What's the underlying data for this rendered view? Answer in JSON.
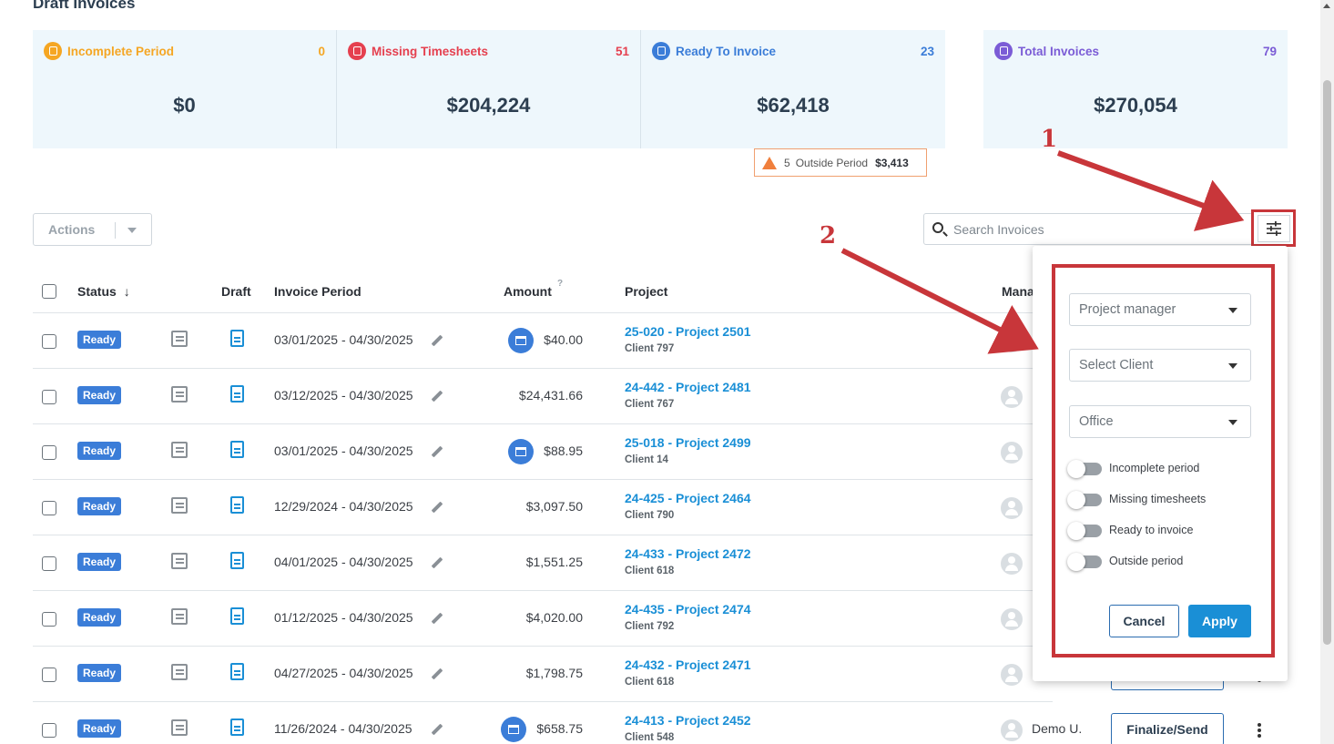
{
  "page": {
    "title": "Draft Invoices"
  },
  "cards": [
    {
      "label": "Incomplete Period",
      "count": "0",
      "amount": "$0",
      "color": "#f5a623"
    },
    {
      "label": "Missing Timesheets",
      "count": "51",
      "amount": "$204,224",
      "color": "#e5404f"
    },
    {
      "label": "Ready To Invoice",
      "count": "23",
      "amount": "$62,418",
      "color": "#3b7dd8"
    },
    {
      "label": "Total Invoices",
      "count": "79",
      "amount": "$270,054",
      "color": "#7b5cd6"
    }
  ],
  "outside_period": {
    "count": "5",
    "label": "Outside Period",
    "amount": "$3,413"
  },
  "toolbar": {
    "actions_label": "Actions",
    "search_placeholder": "Search Invoices"
  },
  "table": {
    "headers": {
      "status": "Status",
      "draft": "Draft",
      "period": "Invoice Period",
      "amount": "Amount",
      "amount_hint": "?",
      "project": "Project",
      "manager": "Mana"
    },
    "rows": [
      {
        "status": "Ready",
        "period": "03/01/2025 - 04/30/2025",
        "amount": "$40.00",
        "bank": true,
        "project": "25-020 - Project 2501",
        "client": "Client 797"
      },
      {
        "status": "Ready",
        "period": "03/12/2025 - 04/30/2025",
        "amount": "$24,431.66",
        "bank": false,
        "project": "24-442 - Project 2481",
        "client": "Client 767"
      },
      {
        "status": "Ready",
        "period": "03/01/2025 - 04/30/2025",
        "amount": "$88.95",
        "bank": true,
        "project": "25-018 - Project 2499",
        "client": "Client 14"
      },
      {
        "status": "Ready",
        "period": "12/29/2024 - 04/30/2025",
        "amount": "$3,097.50",
        "bank": false,
        "project": "24-425 - Project 2464",
        "client": "Client 790"
      },
      {
        "status": "Ready",
        "period": "04/01/2025 - 04/30/2025",
        "amount": "$1,551.25",
        "bank": false,
        "project": "24-433 - Project 2472",
        "client": "Client 618"
      },
      {
        "status": "Ready",
        "period": "01/12/2025 - 04/30/2025",
        "amount": "$4,020.00",
        "bank": false,
        "project": "24-435 - Project 2474",
        "client": "Client 792"
      },
      {
        "status": "Ready",
        "period": "04/27/2025 - 04/30/2025",
        "amount": "$1,798.75",
        "bank": false,
        "project": "24-432 - Project 2471",
        "client": "Client 618"
      },
      {
        "status": "Ready",
        "period": "11/26/2024 - 04/30/2025",
        "amount": "$658.75",
        "bank": true,
        "project": "24-413 - Project 2452",
        "client": "Client 548"
      }
    ],
    "last_row_manager": "Demo U.",
    "finalize_label": "Finalize/Send"
  },
  "filter_panel": {
    "project_manager": "Project manager",
    "client": "Select Client",
    "office": "Office",
    "toggles": [
      "Incomplete period",
      "Missing timesheets",
      "Ready to invoice",
      "Outside period"
    ],
    "cancel_label": "Cancel",
    "apply_label": "Apply"
  },
  "annotations": {
    "one": "1",
    "two": "2"
  }
}
